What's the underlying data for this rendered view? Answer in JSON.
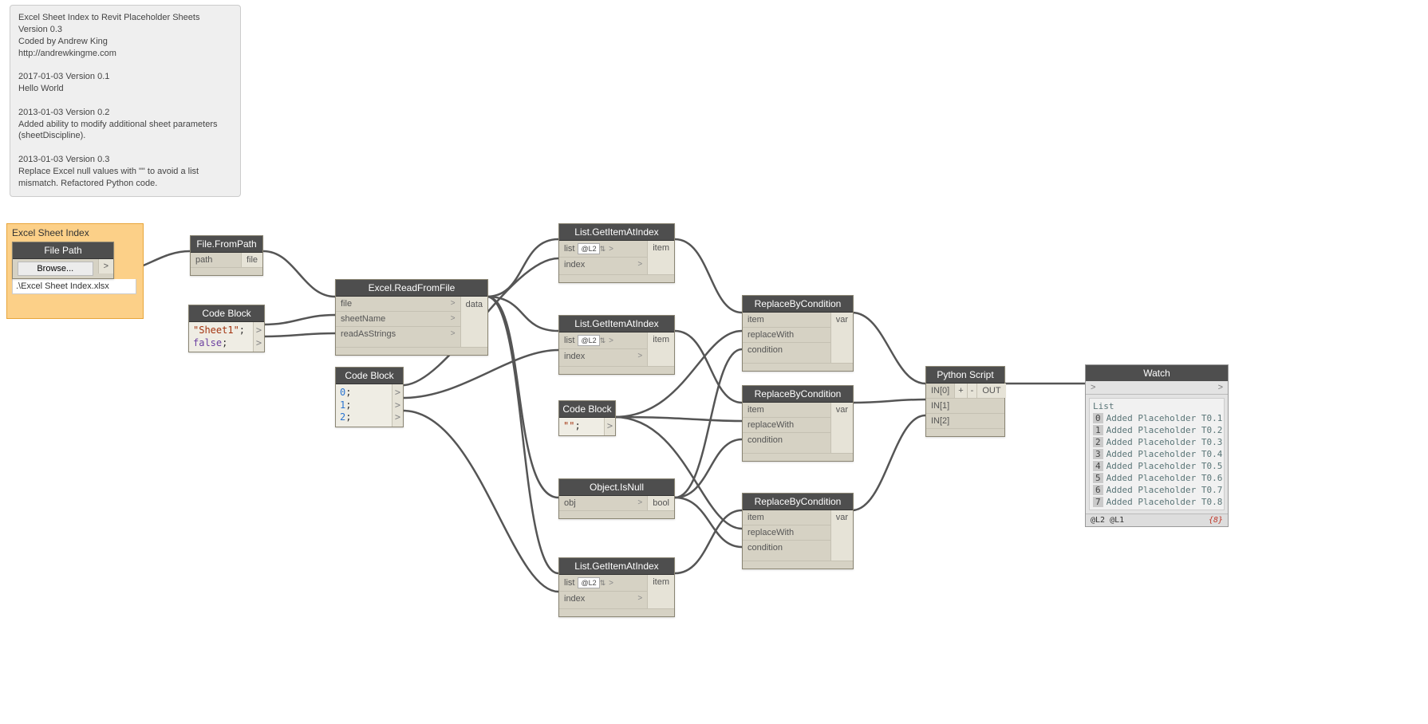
{
  "note": {
    "line1": "Excel Sheet Index to Revit Placeholder Sheets",
    "line2": "Version 0.3",
    "line3": "Coded by Andrew King",
    "line4": "http://andrewkingme.com",
    "line5": "2017-01-03 Version 0.1",
    "line6": "Hello World",
    "line7": "2013-01-03 Version 0.2",
    "line8": "Added ability to modify additional sheet parameters (sheetDiscipline).",
    "line9": "2013-01-03 Version 0.3",
    "line10": "Replace Excel null values with \"\" to avoid a list mismatch. Refactored Python code."
  },
  "group": {
    "title": "Excel Sheet Index"
  },
  "filePath": {
    "title": "File Path",
    "browse": "Browse...",
    "path": ".\\Excel Sheet Index.xlsx",
    "out": ">"
  },
  "fileFromPath": {
    "title": "File.FromPath",
    "in": "path",
    "out": "file"
  },
  "codeBlock1": {
    "title": "Code Block",
    "l1a": "\"Sheet1\"",
    "l1b": ";",
    "l2a": "false",
    "l2b": ";"
  },
  "excelRead": {
    "title": "Excel.ReadFromFile",
    "in1": "file",
    "in2": "sheetName",
    "in3": "readAsStrings",
    "out": "data",
    "chev": ">"
  },
  "codeBlock2": {
    "title": "Code Block",
    "l1": "0",
    "l2": "1",
    "l3": "2",
    "semi": ";"
  },
  "getItem1": {
    "title": "List.GetItemAtIndex",
    "in1": "list",
    "lacing": "@L2",
    "in2": "index",
    "out": "item",
    "chev": ">"
  },
  "getItem2": {
    "title": "List.GetItemAtIndex",
    "in1": "list",
    "lacing": "@L2",
    "in2": "index",
    "out": "item",
    "chev": ">"
  },
  "getItem3": {
    "title": "List.GetItemAtIndex",
    "in1": "list",
    "lacing": "@L2",
    "in2": "index",
    "out": "item",
    "chev": ">"
  },
  "codeBlock3": {
    "title": "Code Block",
    "l1": "\"\"",
    "semi": ";"
  },
  "isNull": {
    "title": "Object.IsNull",
    "in": "obj",
    "out": "bool",
    "chev": ">"
  },
  "replace1": {
    "title": "ReplaceByCondition",
    "in1": "item",
    "in2": "replaceWith",
    "in3": "condition",
    "out": "var"
  },
  "replace2": {
    "title": "ReplaceByCondition",
    "in1": "item",
    "in2": "replaceWith",
    "in3": "condition",
    "out": "var"
  },
  "replace3": {
    "title": "ReplaceByCondition",
    "in1": "item",
    "in2": "replaceWith",
    "in3": "condition",
    "out": "var"
  },
  "python": {
    "title": "Python Script",
    "in0": "IN[0]",
    "in1": "IN[1]",
    "in2": "IN[2]",
    "plus": "+",
    "minus": "-",
    "out": "OUT"
  },
  "watch": {
    "title": "Watch",
    "header": "List",
    "items": [
      "Added Placeholder T0.1",
      "Added Placeholder T0.2",
      "Added Placeholder T0.3",
      "Added Placeholder T0.4",
      "Added Placeholder T0.5",
      "Added Placeholder T0.6",
      "Added Placeholder T0.7",
      "Added Placeholder T0.8"
    ],
    "levels": "@L2 @L1",
    "count": "{8}"
  }
}
